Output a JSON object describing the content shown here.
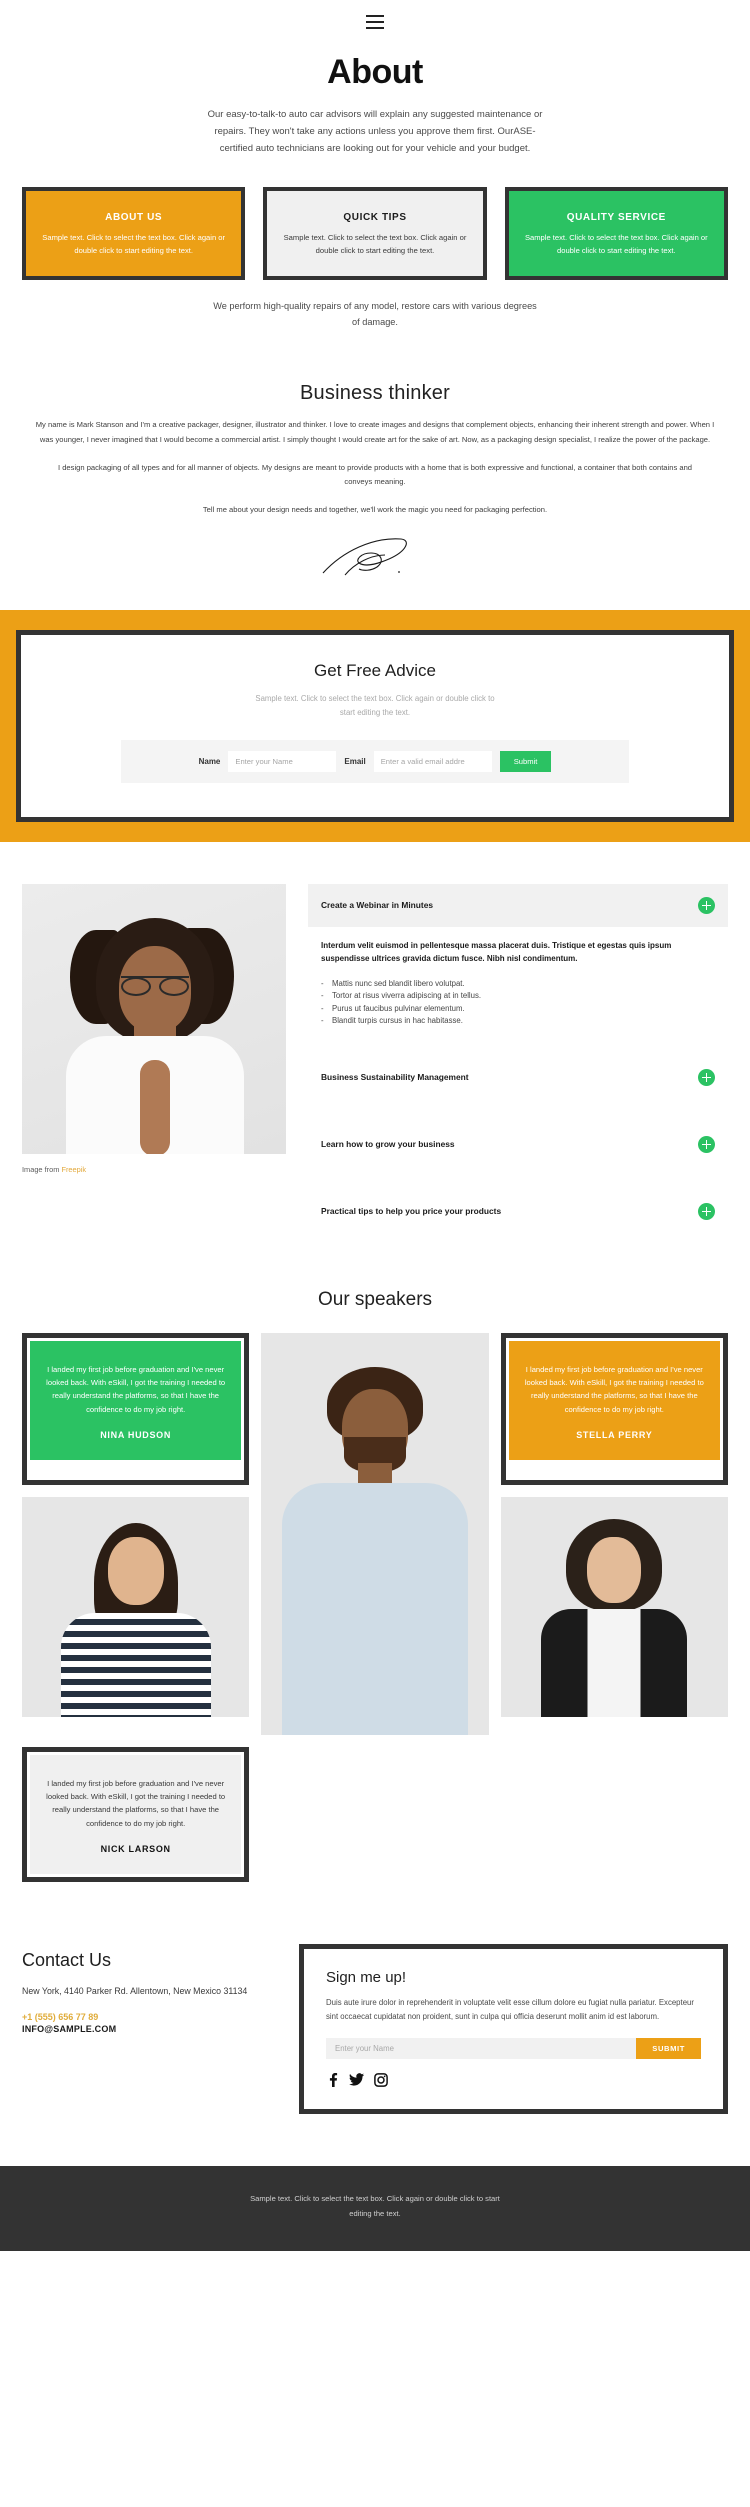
{
  "header": {
    "menu_icon": "hamburger-menu-icon"
  },
  "hero": {
    "title": "About",
    "paragraph": "Our easy-to-talk-to auto car advisors will explain any suggested maintenance or repairs. They won't take any actions unless you approve them first. OurASE-certified auto technicians are looking out for your vehicle and your budget."
  },
  "colors": {
    "orange": "#ECA016",
    "green": "#2BC263",
    "grey": "#F0F0F0",
    "dark": "#333333",
    "gold_link": "#E0AC3A"
  },
  "cards": [
    {
      "title": "ABOUT US",
      "text": "Sample text. Click to select the text box. Click again or double click to start editing the text.",
      "style": "orange"
    },
    {
      "title": "QUICK TIPS",
      "text": "Sample text. Click to select the text box. Click again or double click to start editing the text.",
      "style": "grey"
    },
    {
      "title": "QUALITY SERVICE",
      "text": "Sample text. Click to select the text box. Click again or double click to start editing the text.",
      "style": "green"
    }
  ],
  "cards_note": "We perform high-quality repairs of any model, restore cars with various degrees of damage.",
  "thinker": {
    "title": "Business thinker",
    "p1": "My name is Mark Stanson and I'm a creative packager, designer, illustrator and thinker. I love to create images and designs that complement objects, enhancing their inherent strength and power. When I was younger, I never imagined that I would become a commercial artist. I simply thought I would create art for the sake of art. Now, as a packaging design specialist, I realize the power of the package.",
    "p2": "I design packaging of all types and for all manner of objects. My designs are meant to provide products with a home that is both expressive and functional, a container that both contains and conveys meaning.",
    "p3": "Tell me about your design needs and together, we'll work the magic you need for packaging perfection.",
    "signature_alt": "signature-scribble"
  },
  "advice": {
    "title": "Get Free Advice",
    "subtitle": "Sample text. Click to select the text box. Click again or double click to start editing the text.",
    "name_label": "Name",
    "name_placeholder": "Enter your Name",
    "email_label": "Email",
    "email_placeholder": "Enter a valid email addre",
    "submit_label": "Submit"
  },
  "accordion": {
    "image_credit_prefix": "Image from ",
    "image_credit_link": "Freepik",
    "items": [
      {
        "title": "Create a Webinar in Minutes",
        "open": true,
        "lead": "Interdum velit euismod in pellentesque massa placerat duis. Tristique et egestas quis ipsum suspendisse ultrices gravida dictum fusce. Nibh nisl condimentum.",
        "bullets": [
          "Mattis nunc sed blandit libero volutpat.",
          "Tortor at risus viverra adipiscing at in tellus.",
          "Purus ut faucibus pulvinar elementum.",
          "Blandit turpis cursus in hac habitasse."
        ]
      },
      {
        "title": "Business Sustainability Management",
        "open": false
      },
      {
        "title": "Learn how to grow your business",
        "open": false
      },
      {
        "title": "Practical tips to help you price your products",
        "open": false
      }
    ]
  },
  "speakers": {
    "title": "Our speakers",
    "quote_text": "I landed my first job before graduation and I've never looked back. With eSkill, I got the training I needed to really understand the platforms, so that I have the confidence to do my job right.",
    "items": [
      {
        "name": "NINA HUDSON",
        "style": "green"
      },
      {
        "name": "STELLA PERRY",
        "style": "orange"
      },
      {
        "name": "NICK LARSON",
        "style": "grey"
      }
    ]
  },
  "contact": {
    "title": "Contact Us",
    "address": "New York, 4140 Parker Rd. Allentown, New Mexico 31134",
    "phone": "+1 (555) 656 77 89",
    "email": "INFO@SAMPLE.COM"
  },
  "signup": {
    "title": "Sign me up!",
    "text": "Duis aute irure dolor in reprehenderit in voluptate velit esse cillum dolore eu fugiat nulla pariatur. Excepteur sint occaecat cupidatat non proident, sunt in culpa qui officia deserunt mollit anim id est laborum.",
    "name_placeholder": "Enter your Name",
    "submit_label": "SUBMIT",
    "social_icons": [
      "facebook-icon",
      "twitter-icon",
      "instagram-icon"
    ]
  },
  "footer": {
    "text": "Sample text. Click to select the text box. Click again or double click to start editing the text."
  }
}
